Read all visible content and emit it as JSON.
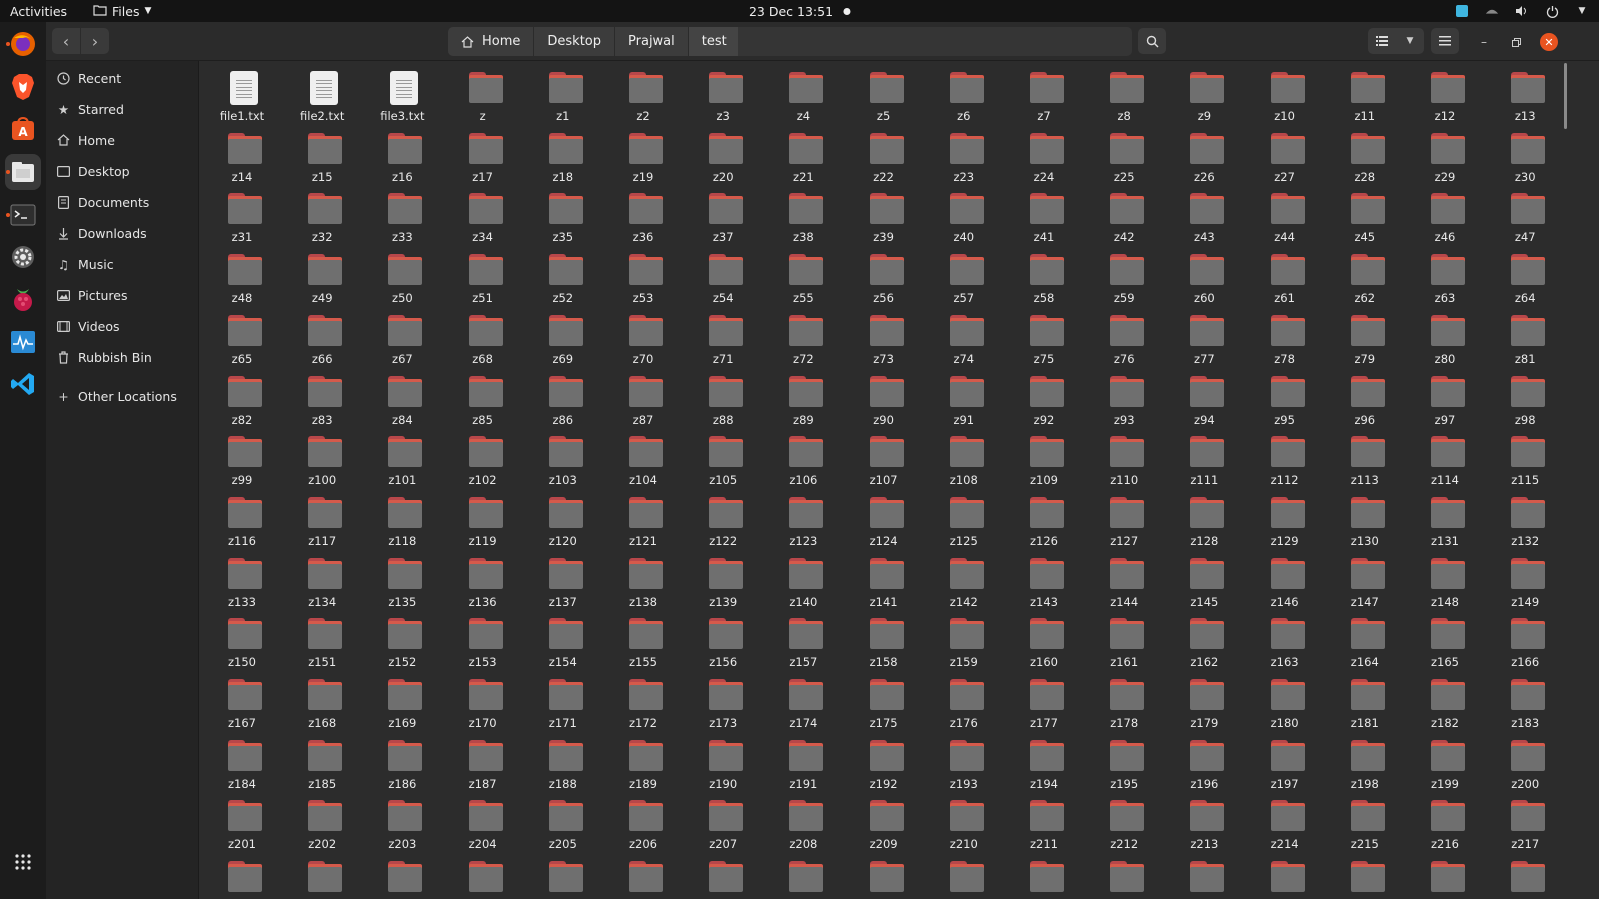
{
  "topbar": {
    "activities": "Activities",
    "app_name": "Files",
    "clock": "23 Dec  13:51"
  },
  "dock": {
    "items": [
      "firefox-icon",
      "brave-icon",
      "software-icon",
      "files-icon",
      "terminal-icon",
      "settings-icon",
      "raspberry-icon",
      "monitor-icon",
      "vscode-icon"
    ]
  },
  "pathbar": {
    "crumbs": [
      "Home",
      "Desktop",
      "Prajwal",
      "test"
    ]
  },
  "sidebar": {
    "items": [
      {
        "label": "Recent",
        "icon": "clock-icon"
      },
      {
        "label": "Starred",
        "icon": "star-icon"
      },
      {
        "label": "Home",
        "icon": "home-icon"
      },
      {
        "label": "Desktop",
        "icon": "desktop-icon"
      },
      {
        "label": "Documents",
        "icon": "document-icon"
      },
      {
        "label": "Downloads",
        "icon": "download-icon"
      },
      {
        "label": "Music",
        "icon": "music-icon"
      },
      {
        "label": "Pictures",
        "icon": "picture-icon"
      },
      {
        "label": "Videos",
        "icon": "video-icon"
      },
      {
        "label": "Rubbish Bin",
        "icon": "trash-icon"
      }
    ],
    "other_locations": "Other Locations"
  },
  "files": [
    "file1.txt",
    "file2.txt",
    "file3.txt"
  ],
  "folders": {
    "prefix": "z",
    "last_numbered": 217,
    "includes_unnumbered": true
  },
  "colors": {
    "accent": "#e95420",
    "folder_body": "#6f6f6f",
    "folder_tab": "#d55a4b"
  }
}
